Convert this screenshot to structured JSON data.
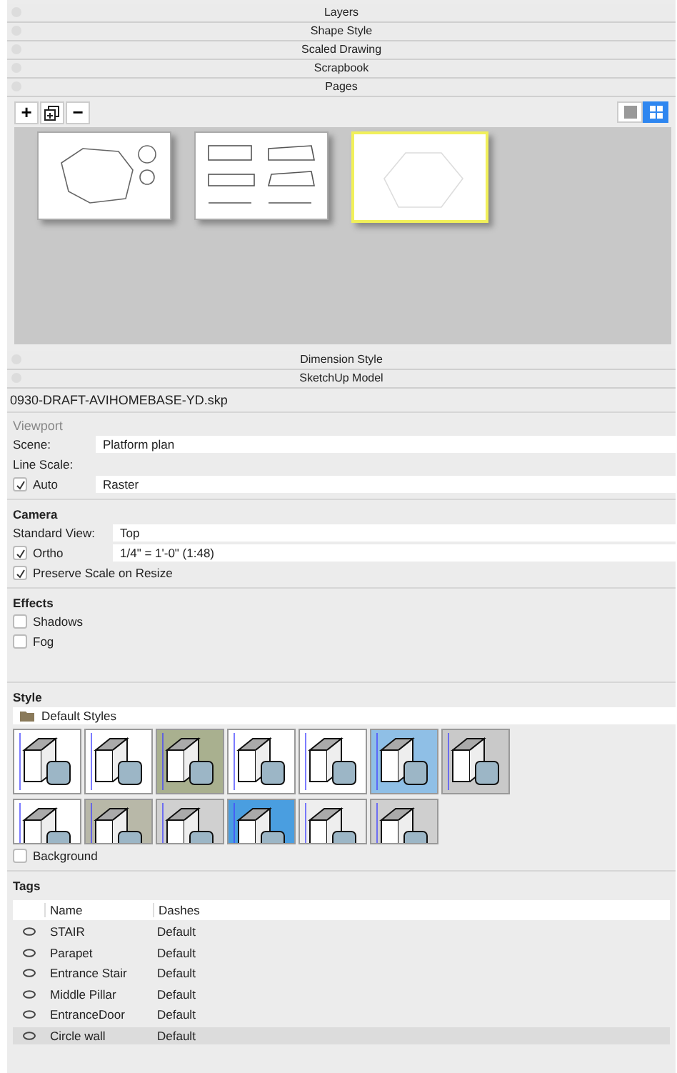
{
  "collapsed_panels_top": [
    "Layers",
    "Shape Style",
    "Scaled Drawing",
    "Scrapbook"
  ],
  "pages": {
    "title": "Pages",
    "toolbar": [
      "+",
      "−"
    ],
    "view_modes": [
      {
        "kind": "list",
        "selected": false
      },
      {
        "kind": "grid",
        "selected": true
      }
    ],
    "thumbnails": [
      {
        "selected": false
      },
      {
        "selected": false
      },
      {
        "selected": true
      }
    ]
  },
  "collapsed_panels_bottom": [
    "Dimension Style"
  ],
  "model": {
    "title": "SketchUp Model",
    "filename": "0930-DRAFT-AVIHOMEBASE-YD.skp",
    "viewport": {
      "title": "Viewport",
      "scene_label": "Scene:",
      "scene": "Platform plan",
      "line_scale_label": "Line Scale:",
      "auto": {
        "label": "Auto",
        "checked": true
      },
      "line_scale": "Raster"
    },
    "camera": {
      "title": "Camera",
      "standard_view_label": "Standard View:",
      "standard_view": "Top",
      "ortho": {
        "label": "Ortho",
        "checked": true
      },
      "scale": "1/4\" = 1'-0\" (1:48)",
      "preserve": {
        "label": "Preserve Scale on Resize",
        "checked": true
      }
    },
    "effects": {
      "title": "Effects",
      "options": [
        {
          "label": "Shadows",
          "checked": false
        },
        {
          "label": "Fog",
          "checked": false
        }
      ]
    },
    "style": {
      "title": "Style",
      "collection": "Default Styles",
      "background": {
        "label": "Background",
        "checked": false
      }
    },
    "tags": {
      "title": "Tags",
      "columns": [
        "Name",
        "Dashes"
      ],
      "rows": [
        {
          "name": "STAIR",
          "dashes": "Default",
          "selected": false
        },
        {
          "name": "Parapet",
          "dashes": "Default",
          "selected": false
        },
        {
          "name": "Entrance Stair",
          "dashes": "Default",
          "selected": false
        },
        {
          "name": "Middle Pillar",
          "dashes": "Default",
          "selected": false
        },
        {
          "name": "EntranceDoor",
          "dashes": "Default",
          "selected": false
        },
        {
          "name": "Circle wall",
          "dashes": "Default",
          "selected": true
        }
      ]
    }
  }
}
